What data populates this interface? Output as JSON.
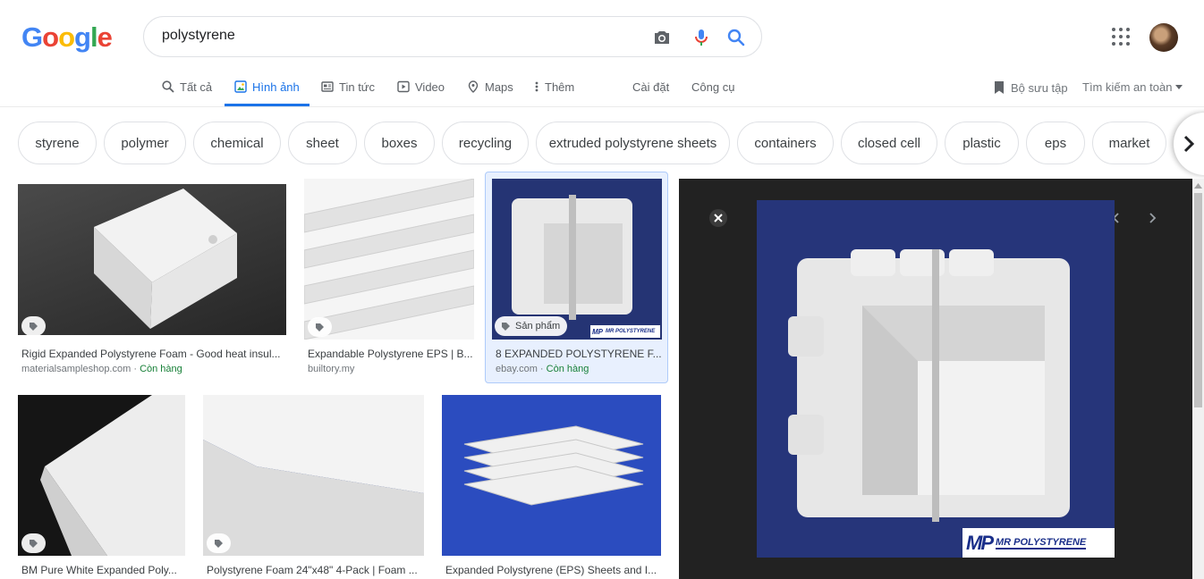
{
  "header": {
    "logo_letters": [
      "G",
      "o",
      "o",
      "g",
      "l",
      "e"
    ],
    "logo_colors": [
      "#4285F4",
      "#EA4335",
      "#FBBC05",
      "#4285F4",
      "#34A853",
      "#EA4335"
    ],
    "search_query": "polystyrene"
  },
  "tabs": [
    {
      "label": "Tất cả",
      "icon": "search-icon"
    },
    {
      "label": "Hình ảnh",
      "icon": "image-icon",
      "active": true
    },
    {
      "label": "Tin tức",
      "icon": "news-icon"
    },
    {
      "label": "Video",
      "icon": "video-icon"
    },
    {
      "label": "Maps",
      "icon": "map-pin-icon"
    },
    {
      "label": "Thêm",
      "icon": "more-vert-icon"
    }
  ],
  "settings_label": "Cài đặt",
  "tools_label": "Công cụ",
  "collections_label": "Bộ sưu tập",
  "safesearch_label": "Tìm kiếm an toàn",
  "chips": [
    "styrene",
    "polymer",
    "chemical",
    "sheet",
    "boxes",
    "recycling",
    "extruded polystyrene sheets",
    "containers",
    "closed cell",
    "plastic",
    "eps",
    "market"
  ],
  "results": [
    {
      "title": "Rigid Expanded Polystyrene Foam - Good heat insul...",
      "source": "materialsampleshop.com",
      "stock": "Còn hàng"
    },
    {
      "title": "Expandable Polystyrene EPS | B...",
      "source": "builtory.my",
      "stock": ""
    },
    {
      "title": "8 EXPANDED POLYSTYRENE F...",
      "source": "ebay.com",
      "stock": "Còn hàng",
      "badge": "Sản phẩm",
      "watermark": "MR POLYSTYRENE",
      "watermark_logo": "MP"
    },
    {
      "title": "BM Pure White Expanded Poly...",
      "source": "",
      "stock": ""
    },
    {
      "title": "Polystyrene Foam 24\"x48\" 4-Pack | Foam ...",
      "source": "",
      "stock": ""
    },
    {
      "title": "Expanded Polystyrene (EPS) Sheets and I...",
      "source": "",
      "stock": ""
    }
  ],
  "preview": {
    "brand_logo": "MP",
    "brand_name": "MR POLYSTYRENE"
  },
  "colors": {
    "accent": "#1a73e8",
    "in_stock": "#188038",
    "panel_bg": "#222222"
  }
}
